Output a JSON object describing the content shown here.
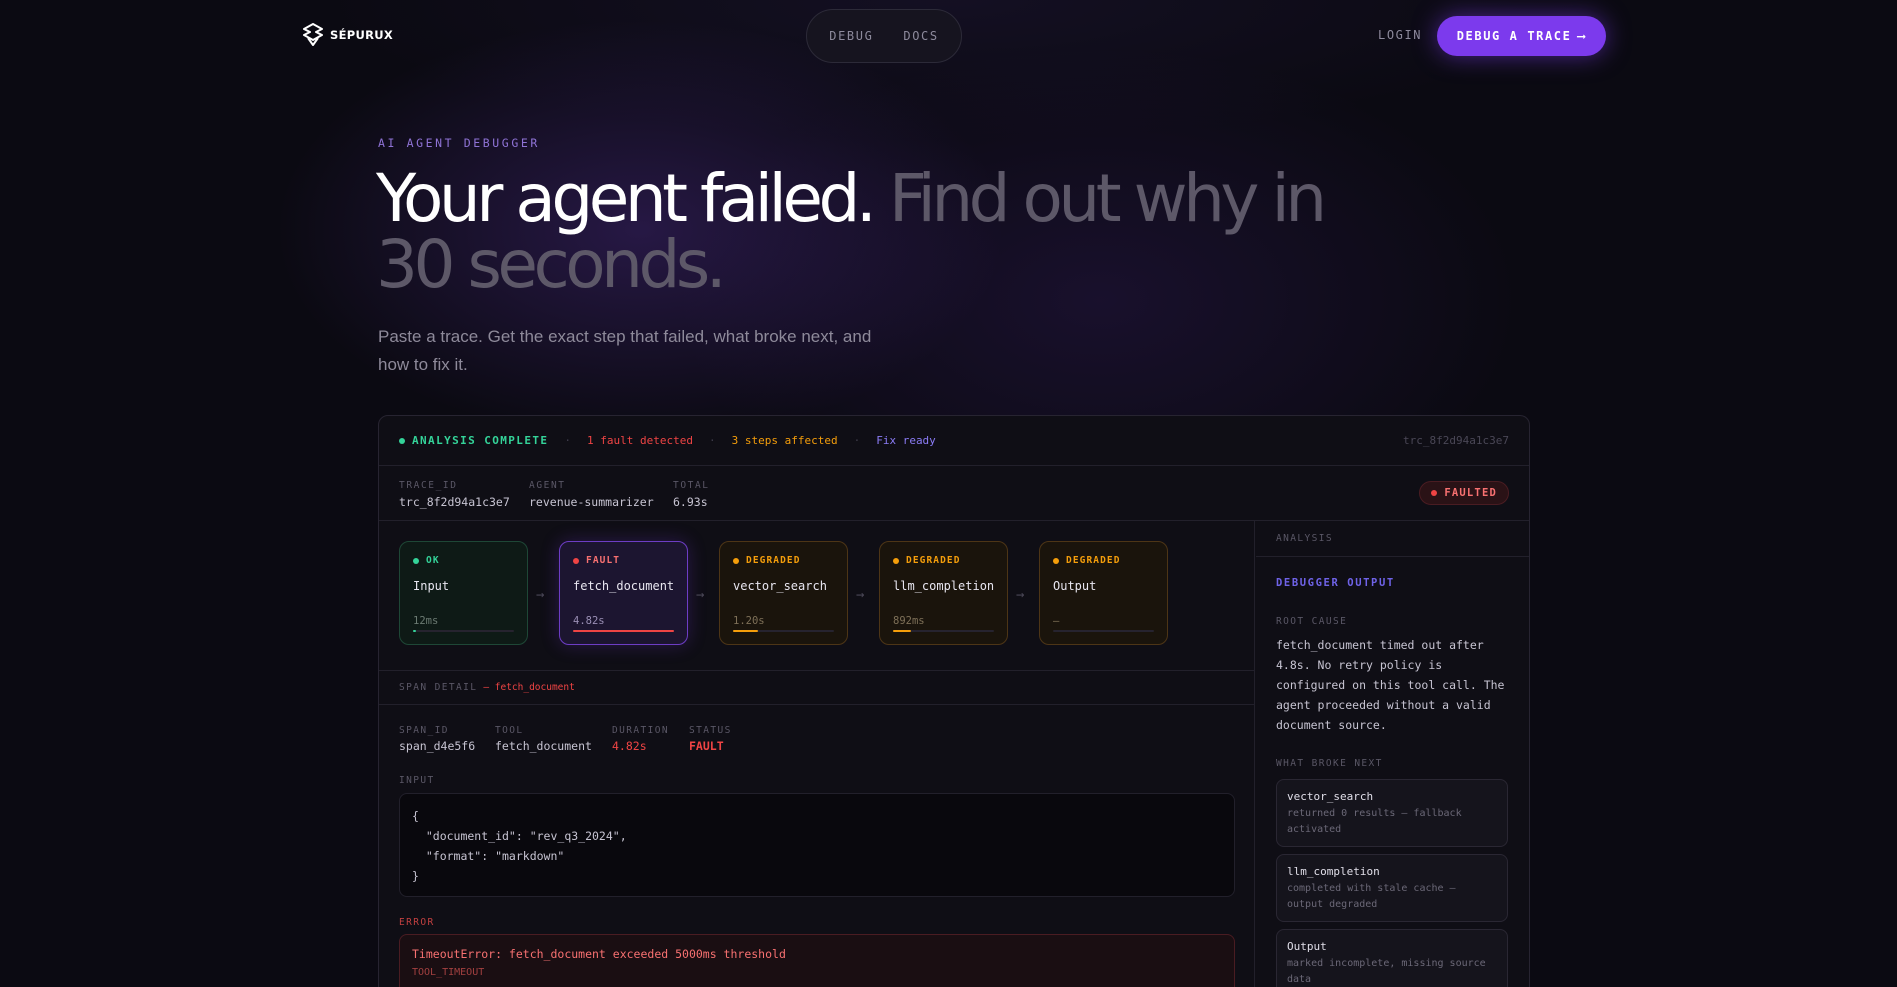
{
  "nav": {
    "brand": "SÉPURUX",
    "links": [
      "DEBUG",
      "DOCS"
    ],
    "login": "LOGIN",
    "cta": "DEBUG A TRACE",
    "cta_arrow": "⟶"
  },
  "hero": {
    "eyebrow": "AI AGENT DEBUGGER",
    "headline_white": "Your agent failed.",
    "headline_gray": "Find out why in 30 seconds.",
    "subtext": "Paste a trace. Get the exact step that failed, what broke next, and how to fix it."
  },
  "status": {
    "complete": "ANALYSIS COMPLETE",
    "faults": "1 fault detected",
    "steps": "3 steps affected",
    "fix": "Fix ready",
    "trace_id": "trc_8f2d94a1c3e7",
    "separator": "·",
    "colors": {
      "ok": "#34d399",
      "fault": "#ef4444",
      "degraded": "#f59e0b",
      "accent": "#7c3aed"
    }
  },
  "trace": {
    "labels": {
      "trace_id": "TRACE_ID",
      "agent": "AGENT",
      "total": "TOTAL"
    },
    "trace_id": "trc_8f2d94a1c3e7",
    "agent": "revenue-summarizer",
    "total": "6.93s",
    "badge": "FAULTED"
  },
  "pipeline": [
    {
      "status": "OK",
      "name": "Input",
      "time": "12ms",
      "kind": "ok",
      "fill": 0.02
    },
    {
      "status": "FAULT",
      "name": "fetch_document",
      "time": "4.82s",
      "kind": "fault",
      "fill": 1.0
    },
    {
      "status": "DEGRADED",
      "name": "vector_search",
      "time": "1.20s",
      "kind": "deg",
      "fill": 0.25
    },
    {
      "status": "DEGRADED",
      "name": "llm_completion",
      "time": "892ms",
      "kind": "deg",
      "fill": 0.18
    },
    {
      "status": "DEGRADED",
      "name": "Output",
      "time": "—",
      "kind": "deg",
      "fill": 0.0
    }
  ],
  "span": {
    "header": "SPAN DETAIL",
    "header_target": "— fetch_document",
    "labels": {
      "span_id": "SPAN_ID",
      "tool": "TOOL",
      "duration": "DURATION",
      "status": "STATUS"
    },
    "span_id": "span_d4e5f6",
    "tool": "fetch_document",
    "duration": "4.82s",
    "status": "FAULT",
    "input_label": "INPUT",
    "input_lines": [
      "{",
      "  \"document_id\": \"rev_q3_2024\",",
      "  \"format\": \"markdown\"",
      "}"
    ],
    "error_label": "ERROR",
    "error_message": "TimeoutError: fetch_document exceeded 5000ms threshold",
    "error_code": "TOOL_TIMEOUT"
  },
  "analysis": {
    "header": "ANALYSIS",
    "title": "DEBUGGER OUTPUT",
    "root_cause_label": "ROOT CAUSE",
    "root_cause": "fetch_document timed out after 4.8s. No retry policy is configured on this tool call. The agent proceeded without a valid document source.",
    "broke_next_label": "WHAT BROKE NEXT",
    "impacts": [
      {
        "name": "vector_search",
        "desc": "returned 0 results — fallback activated"
      },
      {
        "name": "llm_completion",
        "desc": "completed with stale cache — output degraded"
      },
      {
        "name": "Output",
        "desc": "marked incomplete, missing source data"
      }
    ]
  }
}
